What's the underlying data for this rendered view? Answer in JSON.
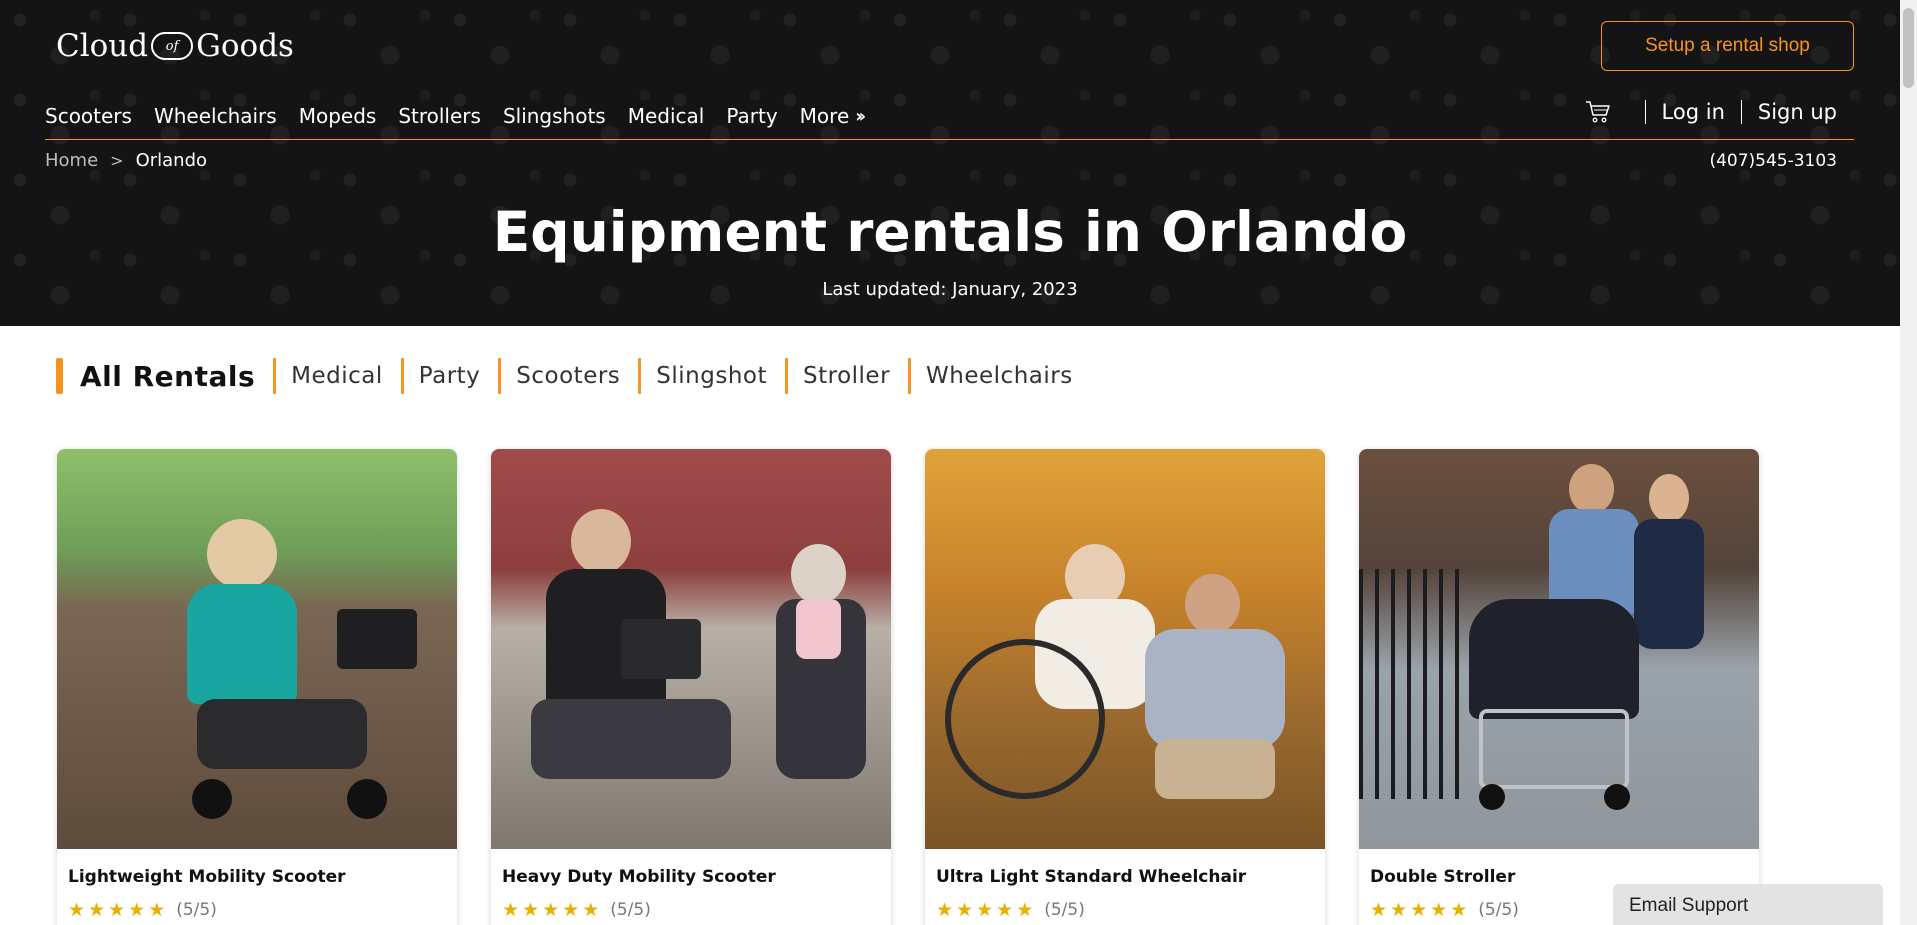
{
  "brand": {
    "left": "Cloud",
    "middle": "of",
    "right": "Goods"
  },
  "header": {
    "setup_label": "Setup a rental shop",
    "nav": [
      "Scooters",
      "Wheelchairs",
      "Mopeds",
      "Strollers",
      "Slingshots",
      "Medical",
      "Party",
      "More"
    ],
    "login": "Log in",
    "signup": "Sign up",
    "phone": "(407)545-3103"
  },
  "breadcrumb": {
    "home": "Home",
    "current": "Orlando"
  },
  "hero": {
    "title": "Equipment rentals in Orlando",
    "updated": "Last updated: January, 2023"
  },
  "categories": [
    "All Rentals",
    "Medical",
    "Party",
    "Scooters",
    "Slingshot",
    "Stroller",
    "Wheelchairs"
  ],
  "products": [
    {
      "name": "Lightweight Mobility Scooter",
      "stars": 5,
      "score": "(5/5)"
    },
    {
      "name": "Heavy Duty Mobility Scooter",
      "stars": 5,
      "score": "(5/5)"
    },
    {
      "name": "Ultra Light Standard Wheelchair",
      "stars": 5,
      "score": "(5/5)"
    },
    {
      "name": "Double Stroller",
      "stars": 5,
      "score": "(5/5)"
    }
  ],
  "support": {
    "label": "Email Support"
  },
  "colors": {
    "accent": "#f7931e",
    "header_bg": "#141414",
    "star": "#e8b100"
  },
  "icons": {
    "cart": "cart-icon",
    "breadcrumb_sep": "chevron-right-icon",
    "more": "double-chevron-right-icon",
    "star": "star-icon"
  }
}
